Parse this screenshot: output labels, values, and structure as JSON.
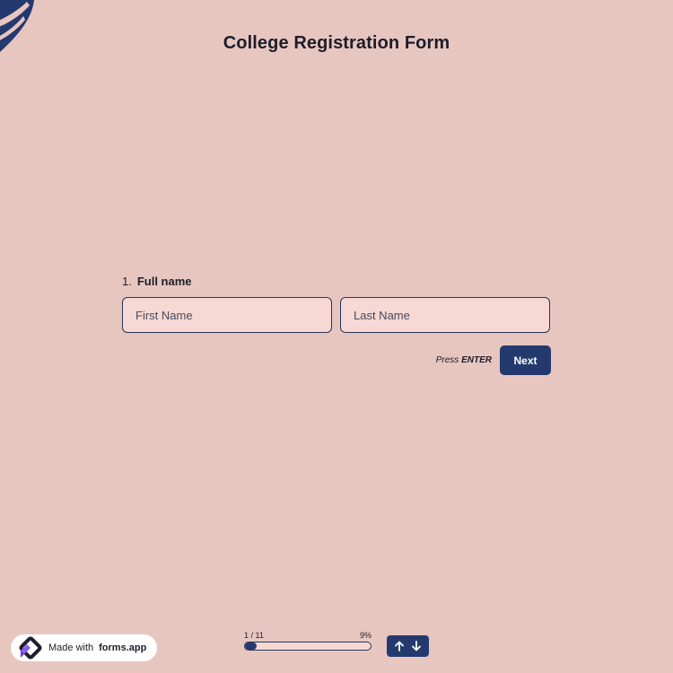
{
  "form": {
    "title": "College Registration Form"
  },
  "question": {
    "number": "1.",
    "label": "Full name",
    "first_name": {
      "value": "",
      "placeholder": "First Name"
    },
    "last_name": {
      "value": "",
      "placeholder": "Last Name"
    }
  },
  "actions": {
    "press_text": "Press",
    "enter_text": "ENTER",
    "next_label": "Next"
  },
  "badge": {
    "made_with": "Made with",
    "brand": "forms.app"
  },
  "progress": {
    "step_text": "1 / 11",
    "percent_text": "9%",
    "fraction": 0.09
  },
  "icons": {
    "corner": "brand-swoosh-icon",
    "badge_logo": "forms-app-logo-icon",
    "up": "arrow-up-icon",
    "down": "arrow-down-icon"
  },
  "colors": {
    "background": "#e8c6c0",
    "accent": "#243a6e",
    "input_bg": "#f6d8d4"
  }
}
